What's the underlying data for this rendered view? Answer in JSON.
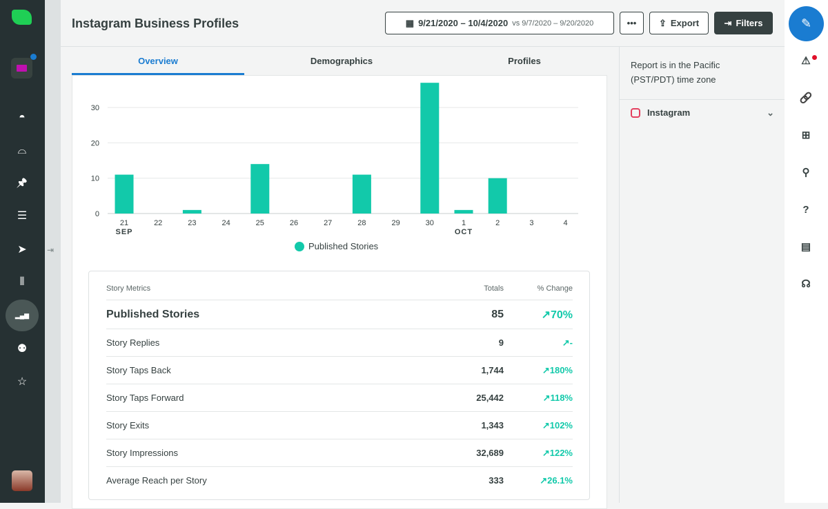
{
  "header": {
    "title": "Instagram Business Profiles",
    "date_range": "9/21/2020 – 10/4/2020",
    "compare": "vs 9/7/2020 – 9/20/2020",
    "more": "•••",
    "export": "Export",
    "filters": "Filters"
  },
  "tabs": [
    {
      "label": "Overview",
      "active": true
    },
    {
      "label": "Demographics"
    },
    {
      "label": "Profiles"
    }
  ],
  "right_panel": {
    "timezone": "Report is in the Pacific (PST/PDT) time zone",
    "network": "Instagram"
  },
  "left_nav": [
    "dashboard-icon",
    "inbox-icon",
    "pin-icon",
    "list-icon",
    "send-icon",
    "listening-icon",
    "reports-icon",
    "bot-icon",
    "star-icon"
  ],
  "right_bar": [
    "compose-icon",
    "alert-icon",
    "link-icon",
    "add-icon",
    "search-icon",
    "help-icon",
    "keyboard-icon",
    "support-icon"
  ],
  "colors": {
    "accent": "#12c9aa",
    "sidebar": "#263133",
    "primary": "#1a7cd1"
  },
  "chart_data": {
    "type": "bar",
    "categories": [
      "21",
      "22",
      "23",
      "24",
      "25",
      "26",
      "27",
      "28",
      "29",
      "30",
      "1",
      "2",
      "3",
      "4"
    ],
    "month_labels": {
      "21": "SEP",
      "1": "OCT"
    },
    "series": [
      {
        "name": "Published Stories",
        "values": [
          11,
          0,
          1,
          0,
          14,
          0,
          0,
          11,
          0,
          37,
          1,
          10,
          0,
          0
        ]
      }
    ],
    "yticks": [
      0,
      10,
      20,
      30
    ],
    "ylim": [
      0,
      38
    ],
    "grid": true,
    "legend": "bottom"
  },
  "metrics": {
    "headers": [
      "Story Metrics",
      "Totals",
      "% Change"
    ],
    "rows": [
      {
        "label": "Published Stories",
        "total": "85",
        "change": "↗70%"
      },
      {
        "label": "Story Replies",
        "total": "9",
        "change": "↗-"
      },
      {
        "label": "Story Taps Back",
        "total": "1,744",
        "change": "↗180%"
      },
      {
        "label": "Story Taps Forward",
        "total": "25,442",
        "change": "↗118%"
      },
      {
        "label": "Story Exits",
        "total": "1,343",
        "change": "↗102%"
      },
      {
        "label": "Story Impressions",
        "total": "32,689",
        "change": "↗122%"
      },
      {
        "label": "Average Reach per Story",
        "total": "333",
        "change": "↗26.1%"
      }
    ]
  }
}
